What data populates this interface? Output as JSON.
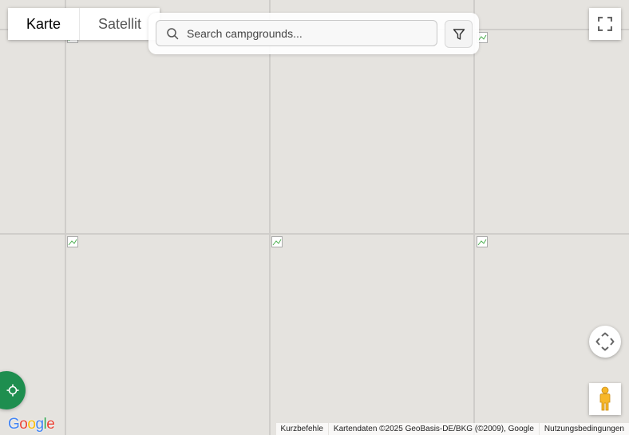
{
  "map_type": {
    "map_label": "Karte",
    "satellite_label": "Satellit"
  },
  "search": {
    "placeholder": "Search campgrounds..."
  },
  "logo": {
    "letters": [
      "G",
      "o",
      "o",
      "g",
      "l",
      "e"
    ],
    "colors": [
      "#4285f4",
      "#ea4335",
      "#fbbc05",
      "#4285f4",
      "#34a853",
      "#ea4335"
    ]
  },
  "attribution": {
    "shortcuts": "Kurzbefehle",
    "map_data": "Kartendaten ©2025 GeoBasis-DE/BKG (©2009), Google",
    "terms": "Nutzungsbedingungen"
  },
  "colors": {
    "map_background": "#e5e3df",
    "locate_button": "#1e8e4f",
    "pegman": "#f7b72a"
  },
  "icons": {
    "search": "search-icon",
    "filter": "filter-icon",
    "fullscreen": "fullscreen-icon",
    "camera_control": "move-camera-icon",
    "street_view": "pegman-icon",
    "locate": "crosshair-icon"
  }
}
